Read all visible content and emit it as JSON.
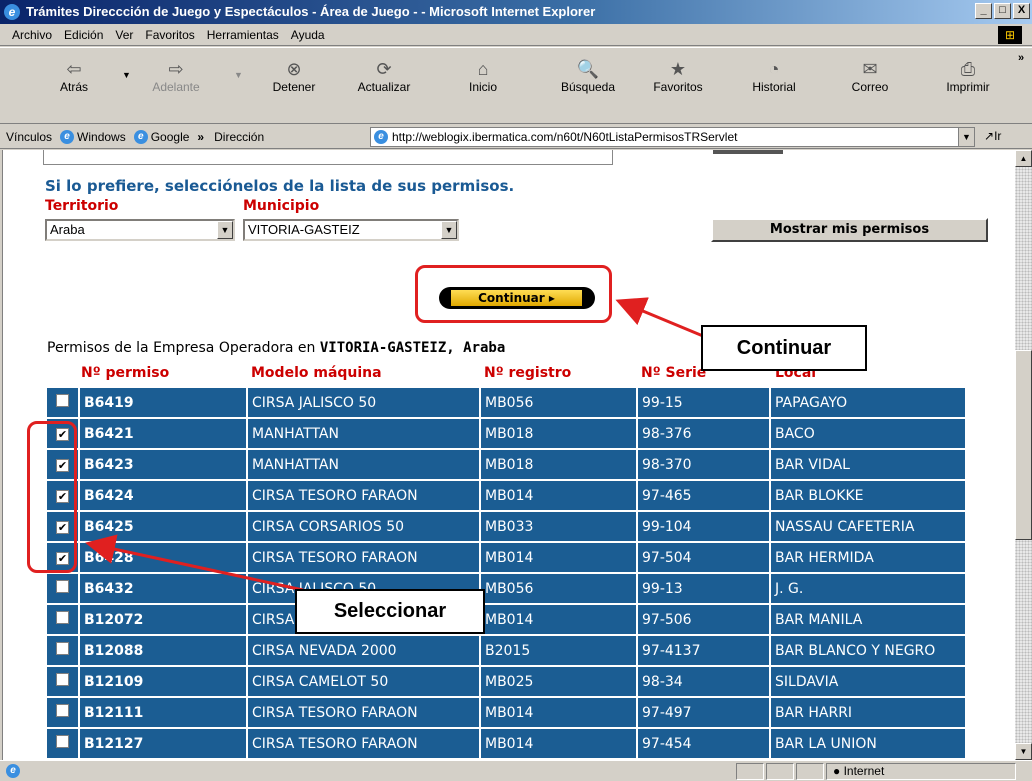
{
  "window": {
    "title": "Trámites Direccción de Juego y Espectáculos - Área de Juego - - Microsoft Internet Explorer",
    "controls": [
      "_",
      "□",
      "X"
    ]
  },
  "menu": [
    "Archivo",
    "Edición",
    "Ver",
    "Favoritos",
    "Herramientas",
    "Ayuda"
  ],
  "toolbar": [
    {
      "label": "Atrás",
      "icon": "back-arrow-icon",
      "glyph": "⇦"
    },
    {
      "label": "Adelante",
      "icon": "forward-arrow-icon",
      "glyph": "⇨"
    },
    {
      "label": "Detener",
      "icon": "stop-icon",
      "glyph": "⊗"
    },
    {
      "label": "Actualizar",
      "icon": "refresh-icon",
      "glyph": "⟳"
    },
    {
      "label": "Inicio",
      "icon": "home-icon",
      "glyph": "⌂"
    },
    {
      "label": "Búsqueda",
      "icon": "search-icon",
      "glyph": "🔍"
    },
    {
      "label": "Favoritos",
      "icon": "favorites-icon",
      "glyph": "★"
    },
    {
      "label": "Historial",
      "icon": "history-icon",
      "glyph": "◔"
    },
    {
      "label": "Correo",
      "icon": "mail-icon",
      "glyph": "✉"
    },
    {
      "label": "Imprimir",
      "icon": "print-icon",
      "glyph": "⎙"
    }
  ],
  "links_bar": {
    "label": "Vínculos",
    "items": [
      "Windows",
      "Google"
    ],
    "address_label": "Dirección",
    "url": "http://weblogix.ibermatica.com/n60t/N60tListaPermisosTRServlet",
    "go": "Ir"
  },
  "page": {
    "intro": "Si lo prefiere, selecciónelos de la lista de sus permisos.",
    "territorio_label": "Territorio",
    "municipio_label": "Municipio",
    "territorio_value": "Araba",
    "municipio_value": "VITORIA-GASTEIZ",
    "mostrar_button": "Mostrar mis permisos",
    "continuar_button": "Continuar ▸",
    "caption_prefix": "Permisos de la Empresa Operadora en",
    "caption_place": "VITORIA-GASTEIZ, Araba"
  },
  "table": {
    "headers": [
      "Nº permiso",
      "Modelo máquina",
      "Nº registro",
      "Nº Serie",
      "Local"
    ],
    "rows": [
      {
        "checked": false,
        "permiso": "B6419",
        "modelo": "CIRSA JALISCO 50",
        "registro": "MB056",
        "serie": "99-15",
        "local": "PAPAGAYO"
      },
      {
        "checked": true,
        "permiso": "B6421",
        "modelo": "MANHATTAN",
        "registro": "MB018",
        "serie": "98-376",
        "local": "BACO"
      },
      {
        "checked": true,
        "permiso": "B6423",
        "modelo": "MANHATTAN",
        "registro": "MB018",
        "serie": "98-370",
        "local": "BAR VIDAL"
      },
      {
        "checked": true,
        "permiso": "B6424",
        "modelo": "CIRSA TESORO FARAON",
        "registro": "MB014",
        "serie": "97-465",
        "local": "BAR BLOKKE"
      },
      {
        "checked": true,
        "permiso": "B6425",
        "modelo": "CIRSA CORSARIOS 50",
        "registro": "MB033",
        "serie": "99-104",
        "local": "NASSAU CAFETERIA"
      },
      {
        "checked": true,
        "permiso": "B6428",
        "modelo": "CIRSA TESORO FARAON",
        "registro": "MB014",
        "serie": "97-504",
        "local": "BAR HERMIDA"
      },
      {
        "checked": false,
        "permiso": "B6432",
        "modelo": "CIRSA JALISCO 50",
        "registro": "MB056",
        "serie": "99-13",
        "local": "J. G."
      },
      {
        "checked": false,
        "permiso": "B12072",
        "modelo": "CIRSA TESORO FARAON",
        "registro": "MB014",
        "serie": "97-506",
        "local": "BAR MANILA"
      },
      {
        "checked": false,
        "permiso": "B12088",
        "modelo": "CIRSA NEVADA 2000",
        "registro": "B2015",
        "serie": "97-4137",
        "local": "BAR BLANCO Y NEGRO"
      },
      {
        "checked": false,
        "permiso": "B12109",
        "modelo": "CIRSA CAMELOT 50",
        "registro": "MB025",
        "serie": "98-34",
        "local": "SILDAVIA"
      },
      {
        "checked": false,
        "permiso": "B12111",
        "modelo": "CIRSA TESORO FARAON",
        "registro": "MB014",
        "serie": "97-497",
        "local": "BAR HARRI"
      },
      {
        "checked": false,
        "permiso": "B12127",
        "modelo": "CIRSA TESORO FARAON",
        "registro": "MB014",
        "serie": "97-454",
        "local": "BAR LA UNION"
      }
    ]
  },
  "callouts": {
    "continuar": "Continuar",
    "seleccionar": "Seleccionar"
  },
  "statusbar": {
    "zone": "Internet"
  },
  "colors": {
    "title_gradient_start": "#0a246a",
    "row_bg": "#1b5d93",
    "header_red": "#cc0000",
    "intro_blue": "#1a5a94",
    "annotation_red": "#e02020",
    "button_gold": "#ffcc00"
  }
}
